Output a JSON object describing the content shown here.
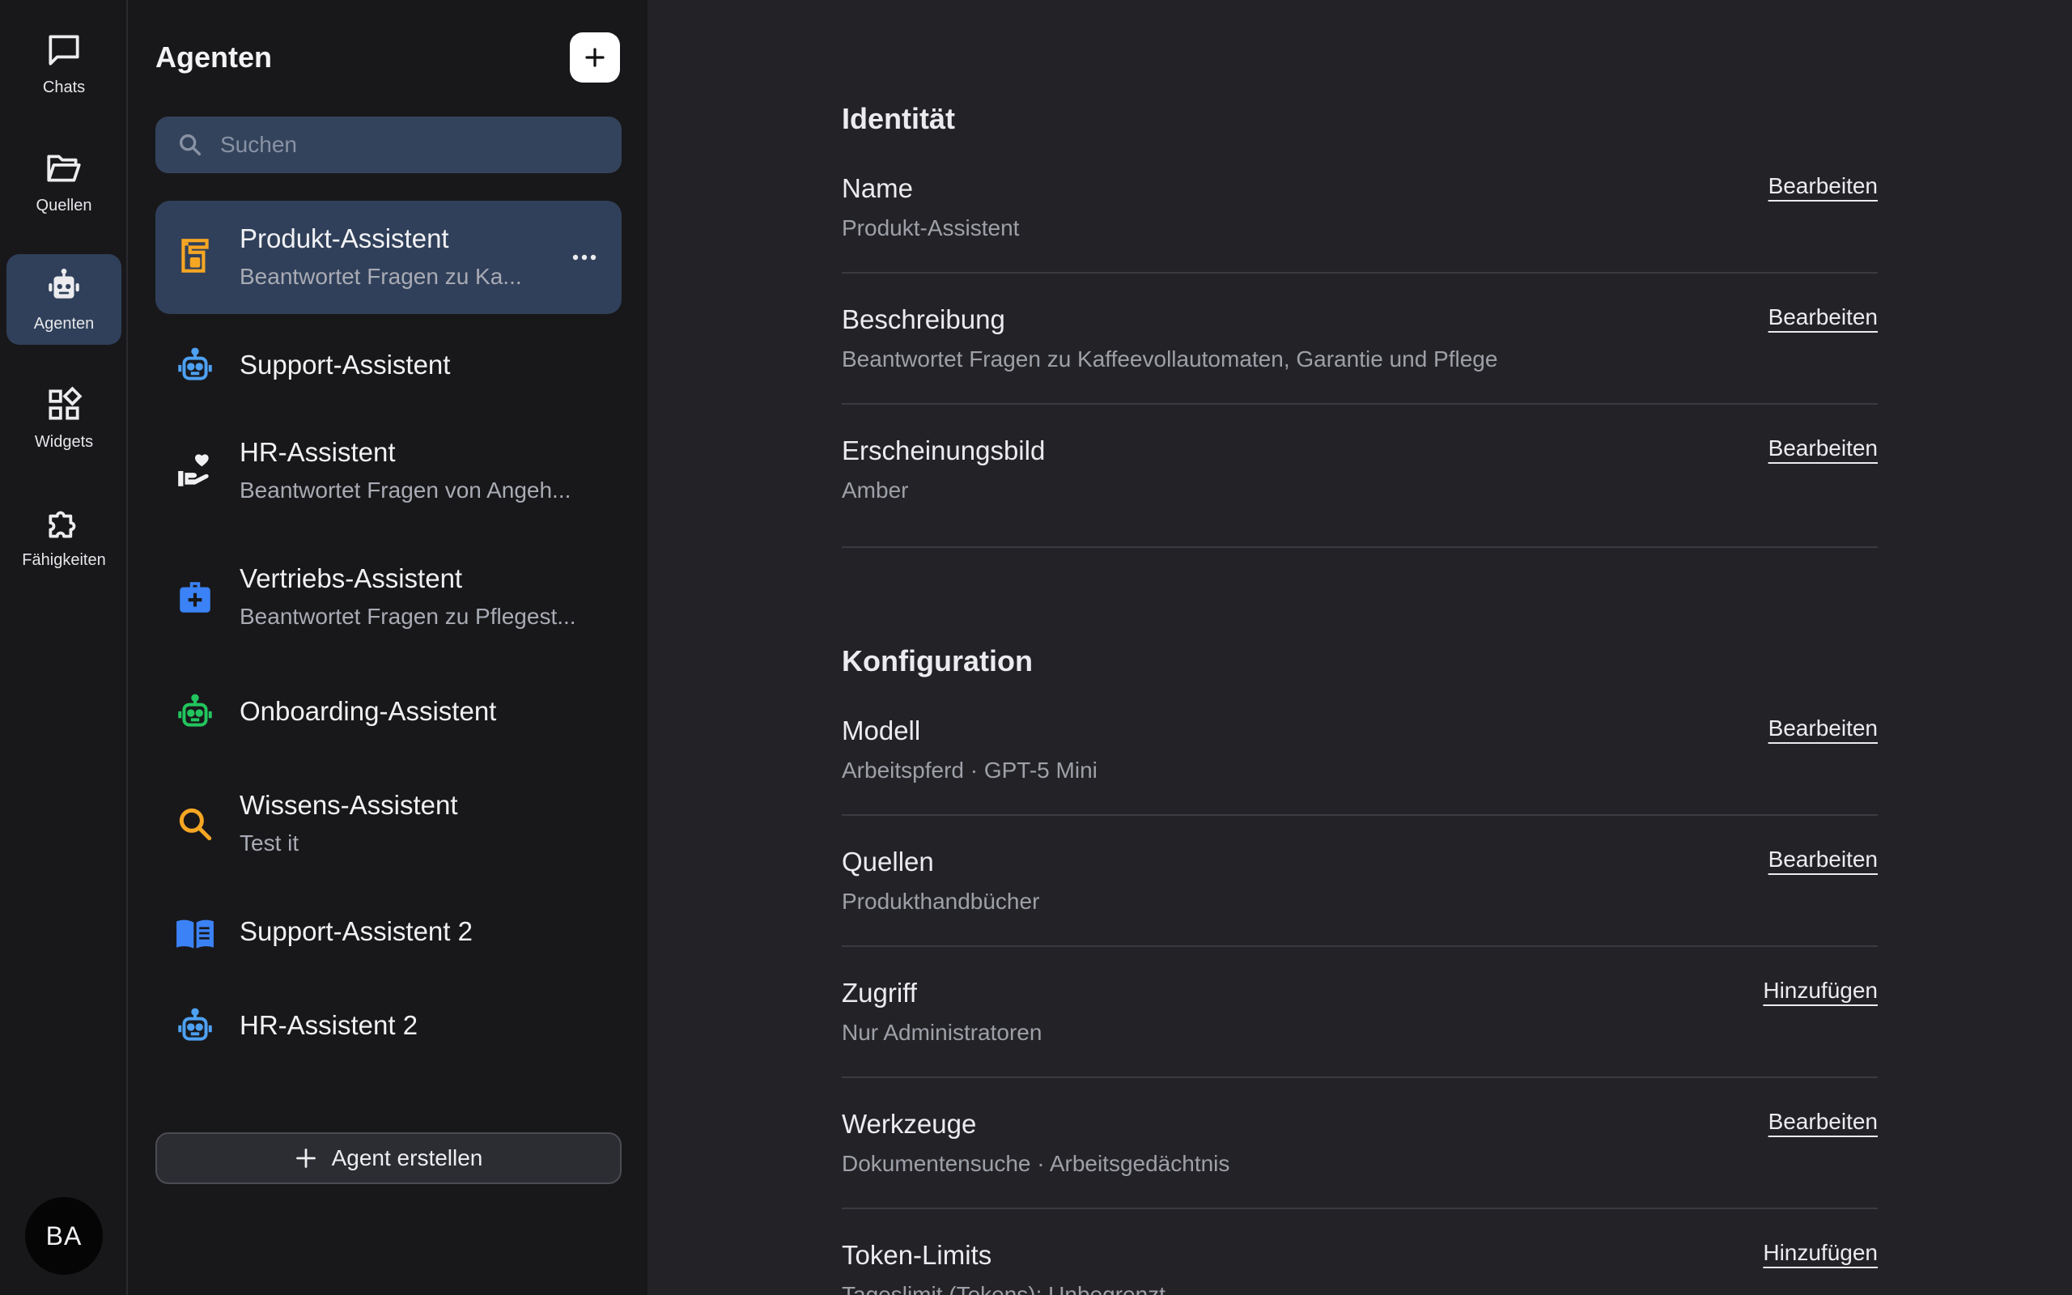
{
  "rail": {
    "items": [
      {
        "label": "Chats",
        "icon": "chat-bubble-icon"
      },
      {
        "label": "Quellen",
        "icon": "folder-open-icon"
      },
      {
        "label": "Agenten",
        "icon": "robot-icon"
      },
      {
        "label": "Widgets",
        "icon": "widgets-icon"
      },
      {
        "label": "Fähigkeiten",
        "icon": "puzzle-icon"
      }
    ],
    "active": "Agenten",
    "avatar": "BA"
  },
  "panel": {
    "title": "Agenten",
    "search_placeholder": "Suchen",
    "agents": [
      {
        "name": "Produkt-Assistent",
        "desc": "Beantwortet Fragen zu Ka...",
        "icon": "coffee-machine-icon",
        "color": "#f5a623"
      },
      {
        "name": "Support-Assistent",
        "desc": "",
        "icon": "robot-icon",
        "color": "#4ea1f3"
      },
      {
        "name": "HR-Assistent",
        "desc": "Beantwortet Fragen von Angeh...",
        "icon": "hand-heart-icon",
        "color": "#f1f1f4"
      },
      {
        "name": "Vertriebs-Assistent",
        "desc": "Beantwortet Fragen zu Pflegest...",
        "icon": "medical-bag-icon",
        "color": "#3b82f6"
      },
      {
        "name": "Onboarding-Assistent",
        "desc": "",
        "icon": "robot-icon",
        "color": "#22c55e"
      },
      {
        "name": "Wissens-Assistent",
        "desc": "Test it",
        "icon": "search-icon",
        "color": "#f5a623"
      },
      {
        "name": "Support-Assistent 2",
        "desc": "",
        "icon": "book-open-icon",
        "color": "#3b82f6"
      },
      {
        "name": "HR-Assistent 2",
        "desc": "",
        "icon": "robot-icon",
        "color": "#4ea1f3"
      }
    ],
    "create_label": "Agent erstellen"
  },
  "main": {
    "identity": {
      "title": "Identität",
      "rows": [
        {
          "label": "Name",
          "value": "Produkt-Assistent",
          "action": "Bearbeiten"
        },
        {
          "label": "Beschreibung",
          "value": "Beantwortet Fragen zu Kaffeevollautomaten, Garantie und Pflege",
          "action": "Bearbeiten"
        },
        {
          "label": "Erscheinungsbild",
          "value": "Amber",
          "action": "Bearbeiten"
        }
      ]
    },
    "config": {
      "title": "Konfiguration",
      "rows": [
        {
          "label": "Modell",
          "value": "Arbeitspferd · GPT-5 Mini",
          "action": "Bearbeiten"
        },
        {
          "label": "Quellen",
          "value": "Produkthandbücher",
          "action": "Bearbeiten"
        },
        {
          "label": "Zugriff",
          "value": "Nur Administratoren",
          "action": "Hinzufügen"
        },
        {
          "label": "Werkzeuge",
          "value": "Dokumentensuche · Arbeitsgedächtnis",
          "action": "Bearbeiten"
        },
        {
          "label": "Token-Limits",
          "value": "Tageslimit (Tokens): Unbegrenzt",
          "action": "Hinzufügen"
        }
      ]
    }
  }
}
